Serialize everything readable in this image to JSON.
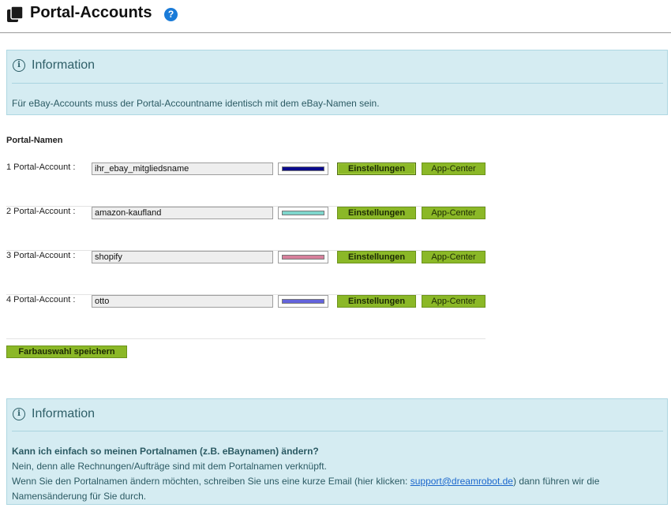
{
  "header": {
    "title": "Portal-Accounts",
    "help_icon": "?"
  },
  "info_top": {
    "icon": "i",
    "title": "Information",
    "text": "Für eBay-Accounts muss der Portal-Accountname identisch mit dem eBay-Namen sein."
  },
  "portal_names": {
    "section_title": "Portal-Namen",
    "accounts": [
      {
        "label": "1 Portal-Account :",
        "value": "ihr_ebay_mitgliedsname",
        "color": "#0a0a8c"
      },
      {
        "label": "2 Portal-Account :",
        "value": "amazon-kaufland",
        "color": "#7fd6cc"
      },
      {
        "label": "3 Portal-Account :",
        "value": "shopify",
        "color": "#d7809c"
      },
      {
        "label": "4 Portal-Account :",
        "value": "otto",
        "color": "#6464dc"
      }
    ],
    "settings_label": "Einstellungen",
    "appcenter_label": "App-Center",
    "save_label": "Farbauswahl speichern"
  },
  "info_bottom": {
    "icon": "i",
    "title": "Information",
    "question": "Kann ich einfach so meinen Portalnamen (z.B. eBaynamen) ändern?",
    "line1": "Nein, denn alle Rechnungen/Aufträge sind mit dem Portalnamen verknüpft.",
    "line2_before": "Wenn Sie den Portalnamen ändern möchten, schreiben Sie uns eine kurze Email (hier klicken: ",
    "email": "support@dreamrobot.de",
    "line2_after": ") dann führen wir die",
    "line3": "Namensänderung für Sie durch."
  }
}
